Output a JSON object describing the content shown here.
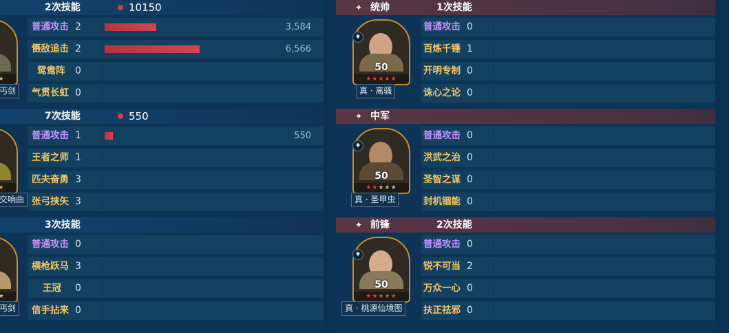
{
  "left_panel": {
    "sections": [
      {
        "skill_count_label": "2次技能",
        "total_damage": "10150",
        "weapon": "丐剑",
        "skills": [
          {
            "name": "普通攻击",
            "count": "2",
            "damage": "3,584",
            "bar_fraction": 0.546,
            "color": "purple"
          },
          {
            "name": "慑敌追击",
            "count": "2",
            "damage": "6,566",
            "bar_fraction": 1.0,
            "color": "gold"
          },
          {
            "name": "鸳鸯阵",
            "count": "0",
            "damage": "",
            "bar_fraction": 0,
            "color": "gold"
          },
          {
            "name": "气贯长虹",
            "count": "0",
            "damage": "",
            "bar_fraction": 0,
            "color": "gold"
          }
        ]
      },
      {
        "skill_count_label": "7次技能",
        "total_damage": "550",
        "weapon": "交响曲",
        "skills": [
          {
            "name": "普通攻击",
            "count": "1",
            "damage": "550",
            "bar_fraction": 0.084,
            "color": "purple"
          },
          {
            "name": "王者之师",
            "count": "1",
            "damage": "",
            "bar_fraction": 0,
            "color": "gold"
          },
          {
            "name": "匹夫奋勇",
            "count": "3",
            "damage": "",
            "bar_fraction": 0,
            "color": "gold"
          },
          {
            "name": "张弓挟矢",
            "count": "3",
            "damage": "",
            "bar_fraction": 0,
            "color": "gold"
          }
        ]
      },
      {
        "skill_count_label": "3次技能",
        "total_damage": "",
        "weapon": "丐剑",
        "skills": [
          {
            "name": "普通攻击",
            "count": "0",
            "damage": "",
            "bar_fraction": 0,
            "color": "purple"
          },
          {
            "name": "横枪跃马",
            "count": "3",
            "damage": "",
            "bar_fraction": 0,
            "color": "gold"
          },
          {
            "name": "王冠",
            "count": "0",
            "damage": "",
            "bar_fraction": 0,
            "color": "gold"
          },
          {
            "name": "信手拈来",
            "count": "0",
            "damage": "",
            "bar_fraction": 0,
            "color": "gold"
          }
        ]
      }
    ]
  },
  "right_panel": {
    "sections": [
      {
        "role": "统帅",
        "skill_count_label": "1次技能",
        "level": "50",
        "stars_red": 5,
        "weapon": "真 · 离骚",
        "skills": [
          {
            "name": "普通攻击",
            "count": "0",
            "color": "purple"
          },
          {
            "name": "百炼千锤",
            "count": "1",
            "color": "gold"
          },
          {
            "name": "开明专制",
            "count": "0",
            "color": "gold"
          },
          {
            "name": "诛心之论",
            "count": "0",
            "color": "gold"
          }
        ]
      },
      {
        "role": "中军",
        "skill_count_label": "",
        "level": "50",
        "stars_red": 2,
        "weapon": "真 · 圣甲虫",
        "skills": [
          {
            "name": "普通攻击",
            "count": "0",
            "color": "purple"
          },
          {
            "name": "洪武之治",
            "count": "0",
            "color": "gold"
          },
          {
            "name": "圣智之谋",
            "count": "0",
            "color": "gold"
          },
          {
            "name": "封机锢能",
            "count": "0",
            "color": "gold"
          }
        ]
      },
      {
        "role": "前锋",
        "skill_count_label": "2次技能",
        "level": "50",
        "stars_red": 5,
        "weapon": "真 · 桃源仙境图",
        "skills": [
          {
            "name": "普通攻击",
            "count": "0",
            "color": "purple"
          },
          {
            "name": "锐不可当",
            "count": "2",
            "color": "gold"
          },
          {
            "name": "万众一心",
            "count": "0",
            "color": "gold"
          },
          {
            "name": "扶正祛邪",
            "count": "0",
            "color": "gold"
          }
        ]
      }
    ]
  },
  "symbols": {
    "header_star": "✦"
  },
  "colors": {
    "skill_purple": "#c592ff",
    "skill_gold": "#f2c465",
    "damage_bar": "#c53c47",
    "frame_gold": "#c98d28"
  }
}
